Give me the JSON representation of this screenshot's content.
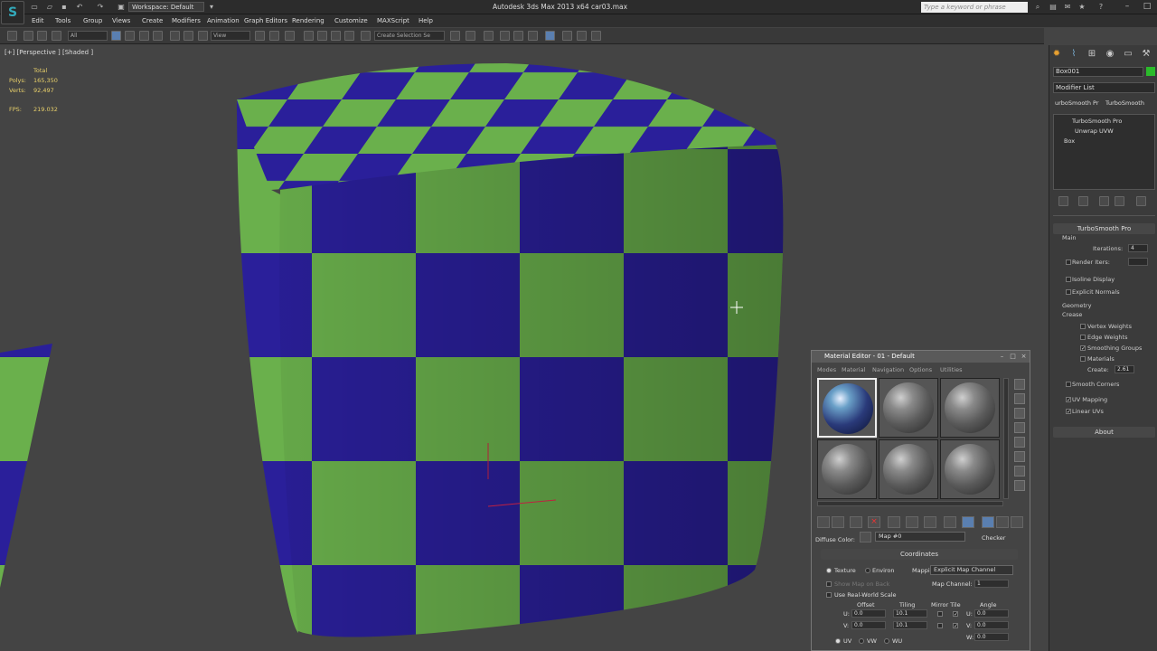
{
  "app": {
    "title": "Autodesk 3ds Max  2013 x64      car03.max",
    "workspace": "Workspace: Default",
    "search_placeholder": "Type a keyword or phrase"
  },
  "menu": [
    "Edit",
    "Tools",
    "Group",
    "Views",
    "Create",
    "Modifiers",
    "Animation",
    "Graph Editors",
    "Rendering",
    "Customize",
    "MAXScript",
    "Help"
  ],
  "toolbar": {
    "filter": "All",
    "ref_coord": "View",
    "selection_set": "Create Selection Se"
  },
  "viewport": {
    "label": "[+] [Perspective ] [Shaded ]",
    "stats": {
      "total_label": "Total",
      "polys_label": "Polys:",
      "polys_value": "165,350",
      "verts_label": "Verts:",
      "verts_value": "92,497",
      "fps_label": "FPS:",
      "fps_value": "219.032"
    },
    "checker_colors": {
      "a": "#6ab04c",
      "b": "#2a1f9a"
    }
  },
  "command_panel": {
    "object_name": "Box001",
    "object_color": "#2bbb2b",
    "modifier_list": "Modifier List",
    "mod_buttons": [
      "urboSmooth Pr",
      "TurboSmooth"
    ],
    "stack": [
      "TurboSmooth Pro",
      "Unwrap UVW",
      "Box"
    ],
    "rollout": {
      "title": "TurboSmooth Pro",
      "main": "Main",
      "iterations_label": "Iterations:",
      "iterations_value": "4",
      "render_iters_label": "Render Iters:",
      "isoline": "Isoline Display",
      "explicit_normals": "Explicit Normals",
      "geometry": "Geometry",
      "crease": "Crease",
      "vertex_weights": "Vertex Weights",
      "edge_weights": "Edge Weights",
      "smoothing_groups": "Smoothing Groups",
      "materials": "Materials",
      "create_label": "Create:",
      "create_value": "2.61",
      "smooth_corners": "Smooth Corners",
      "uv_mapping": "UV Mapping",
      "linear_uvs": "Linear UVs"
    },
    "about": "About"
  },
  "material_editor": {
    "title": "Material Editor - 01 - Default",
    "menu": [
      "Modes",
      "Material",
      "Navigation",
      "Options",
      "Utilities"
    ],
    "diffuse_label": "Diffuse Color:",
    "map_name": "Map #0",
    "map_type": "Checker",
    "coordinates_title": "Coordinates",
    "texture": "Texture",
    "environ": "Environ",
    "mapping_label": "Mapping:",
    "mapping_value": "Explicit Map Channel",
    "show_map": "Show Map on Back",
    "map_channel_label": "Map Channel:",
    "map_channel_value": "1",
    "real_world": "Use Real-World Scale",
    "offset": "Offset",
    "tiling": "Tiling",
    "mirror_tile": "Mirror Tile",
    "angle": "Angle",
    "u_label": "U:",
    "v_label": "V:",
    "w_label": "W:",
    "u_offset": "0.0",
    "v_offset": "0.0",
    "u_tiling": "10.1",
    "v_tiling": "10.1",
    "u_angle": "0.0",
    "v_angle": "0.0",
    "w_angle": "0.0",
    "uv": "UV",
    "vw": "VW",
    "wu": "WU"
  }
}
